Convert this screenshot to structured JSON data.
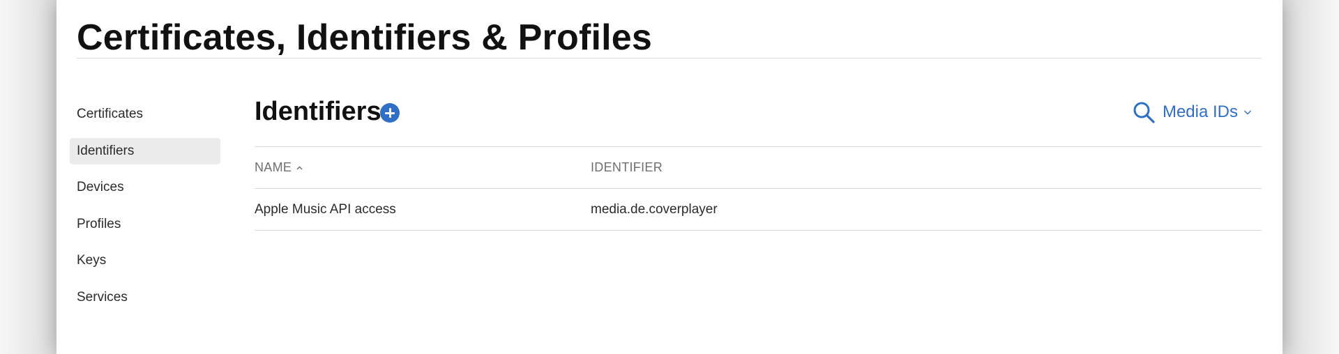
{
  "page": {
    "title": "Certificates, Identifiers & Profiles"
  },
  "sidebar": {
    "items": [
      {
        "label": "Certificates",
        "active": false
      },
      {
        "label": "Identifiers",
        "active": true
      },
      {
        "label": "Devices",
        "active": false
      },
      {
        "label": "Profiles",
        "active": false
      },
      {
        "label": "Keys",
        "active": false
      },
      {
        "label": "Services",
        "active": false
      }
    ]
  },
  "section": {
    "title": "Identifiers",
    "add_icon": "plus-circle-icon",
    "search_icon": "search-icon",
    "filter_label": "Media IDs",
    "filter_icon": "chevron-down-icon"
  },
  "table": {
    "columns": [
      {
        "label": "NAME",
        "sorted": "ascending"
      },
      {
        "label": "IDENTIFIER"
      }
    ],
    "rows": [
      {
        "name": "Apple Music API access",
        "identifier": "media.de.coverplayer"
      }
    ]
  },
  "colors": {
    "accent": "#2f6fc6",
    "active_item_bg": "#ececec",
    "divider": "#d9d9d9"
  }
}
